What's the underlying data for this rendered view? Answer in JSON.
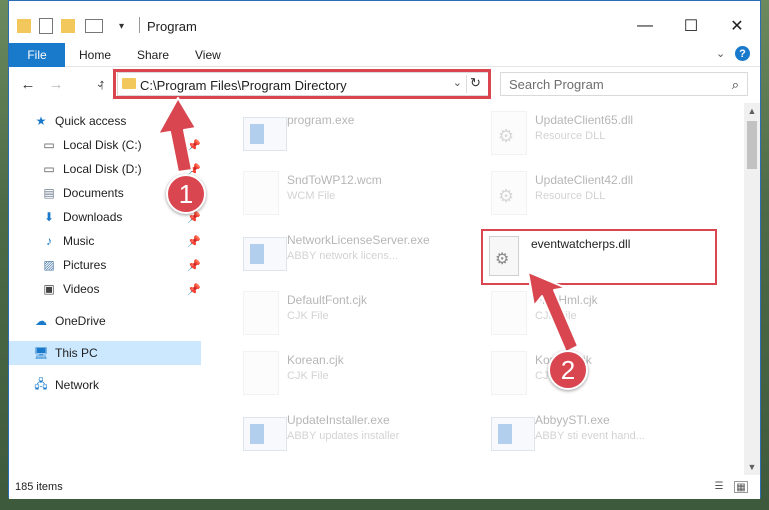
{
  "window": {
    "title": "Program",
    "minimize_glyph": "—",
    "maximize_glyph": "☐",
    "close_glyph": "✕"
  },
  "ribbon": {
    "tabs": [
      "File",
      "Home",
      "Share",
      "View"
    ],
    "help_glyph": "?"
  },
  "navigation": {
    "back_glyph": "←",
    "forward_glyph": "→",
    "up_glyph": "↑",
    "address": "C:\\Program Files\\Program Directory",
    "search_placeholder": "Search Program"
  },
  "sidebar": {
    "items": [
      {
        "label": "Quick access",
        "icon": "star-icon",
        "pinned": false
      },
      {
        "label": "Local Disk (C:)",
        "icon": "drive-icon",
        "pinned": true
      },
      {
        "label": "Local Disk (D:)",
        "icon": "drive-icon",
        "pinned": true
      },
      {
        "label": "Documents",
        "icon": "documents-icon",
        "pinned": true
      },
      {
        "label": "Downloads",
        "icon": "download-icon",
        "pinned": true
      },
      {
        "label": "Music",
        "icon": "music-icon",
        "pinned": true
      },
      {
        "label": "Pictures",
        "icon": "pictures-icon",
        "pinned": true
      },
      {
        "label": "Videos",
        "icon": "videos-icon",
        "pinned": true
      },
      {
        "label": "OneDrive",
        "icon": "cloud-icon",
        "pinned": false
      },
      {
        "label": "This PC",
        "icon": "computer-icon",
        "pinned": false,
        "selected": true
      },
      {
        "label": "Network",
        "icon": "network-icon",
        "pinned": false
      }
    ]
  },
  "files": [
    {
      "name": "program.exe",
      "type": "",
      "icon": "exe-icon"
    },
    {
      "name": "UpdateClient65.dll",
      "type": "Resource DLL",
      "icon": "dll-icon"
    },
    {
      "name": "SndToWP12.wcm",
      "type": "WCM File",
      "icon": "file-icon"
    },
    {
      "name": "UpdateClient42.dll",
      "type": "Resource DLL",
      "icon": "dll-icon"
    },
    {
      "name": "NetworkLicenseServer.exe",
      "type": "ABBY network licens...",
      "icon": "app-icon"
    },
    {
      "name": "eventwatcherps.dll",
      "type": "",
      "icon": "dll-icon",
      "highlighted": true
    },
    {
      "name": "DefaultFont.cjk",
      "type": "CJK File",
      "icon": "file-icon"
    },
    {
      "name": "FineHml.cjk",
      "type": "CJK File",
      "icon": "file-icon"
    },
    {
      "name": "Korean.cjk",
      "type": "CJK File",
      "icon": "file-icon"
    },
    {
      "name": "Korean.cjk",
      "type": "CJK File",
      "icon": "file-icon"
    },
    {
      "name": "UpdateInstaller.exe",
      "type": "ABBY updates installer",
      "icon": "app-icon"
    },
    {
      "name": "AbbyySTI.exe",
      "type": "ABBY sti event hand...",
      "icon": "app-icon"
    }
  ],
  "status": {
    "item_count": "185 items"
  },
  "annotations": {
    "callout_1": "1",
    "callout_2": "2",
    "color": "#d9464f"
  }
}
